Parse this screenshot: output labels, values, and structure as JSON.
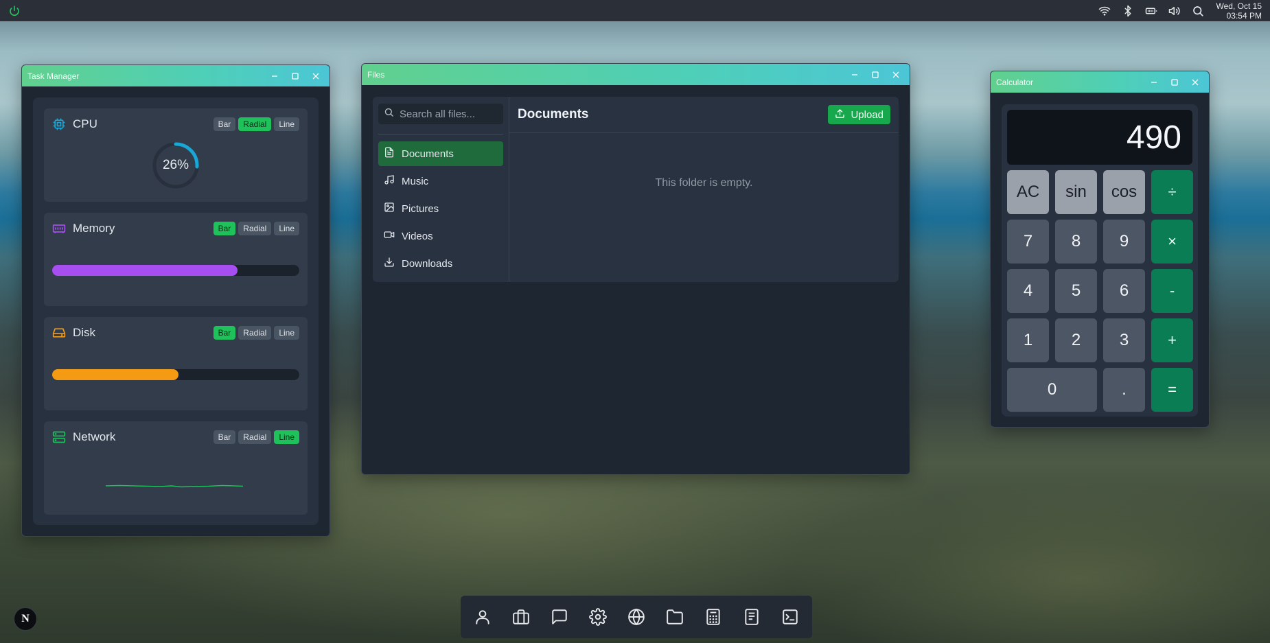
{
  "topbar": {
    "power_icon": "power-icon",
    "tray_icons": [
      "wifi-icon",
      "bluetooth-icon",
      "battery-icon",
      "volume-icon",
      "search-icon"
    ],
    "date": "Wed, Oct 15",
    "time": "03:54 PM"
  },
  "task_manager": {
    "title": "Task Manager",
    "segment_labels": {
      "bar": "Bar",
      "radial": "Radial",
      "line": "Line"
    },
    "cards": [
      {
        "name": "CPU",
        "icon": "cpu-icon",
        "mode": "Radial",
        "value_text": "26%",
        "value": 26,
        "color": "#1aa7d6"
      },
      {
        "name": "Memory",
        "icon": "memory-icon",
        "mode": "Bar",
        "value": 75,
        "color": "#a64ef0"
      },
      {
        "name": "Disk",
        "icon": "disk-icon",
        "mode": "Bar",
        "value": 51,
        "color": "#f59a13"
      },
      {
        "name": "Network",
        "icon": "network-icon",
        "mode": "Line",
        "color": "#1fc15a"
      }
    ]
  },
  "files": {
    "title": "Files",
    "search_placeholder": "Search all files...",
    "sidebar": [
      {
        "label": "Documents",
        "icon": "document-icon",
        "active": true
      },
      {
        "label": "Music",
        "icon": "music-icon",
        "active": false
      },
      {
        "label": "Pictures",
        "icon": "image-icon",
        "active": false
      },
      {
        "label": "Videos",
        "icon": "video-icon",
        "active": false
      },
      {
        "label": "Downloads",
        "icon": "download-icon",
        "active": false
      }
    ],
    "current_folder": "Documents",
    "upload_label": "Upload",
    "empty_text": "This folder is empty."
  },
  "calculator": {
    "title": "Calculator",
    "display": "490",
    "keys": [
      [
        "AC",
        "sin",
        "cos",
        "÷"
      ],
      [
        "7",
        "8",
        "9",
        "×"
      ],
      [
        "4",
        "5",
        "6",
        "-"
      ],
      [
        "1",
        "2",
        "3",
        "+"
      ],
      [
        "0",
        ".",
        "="
      ]
    ]
  },
  "dock": {
    "items": [
      "user-icon",
      "briefcase-icon",
      "chat-icon",
      "settings-icon",
      "globe-icon",
      "folder-icon",
      "calculator-icon",
      "notebook-icon",
      "terminal-icon"
    ]
  },
  "logo_badge": "N",
  "colors": {
    "accent_green": "#1fc15a",
    "title_gradient": [
      "#61d08e",
      "#4cc6d6"
    ]
  }
}
